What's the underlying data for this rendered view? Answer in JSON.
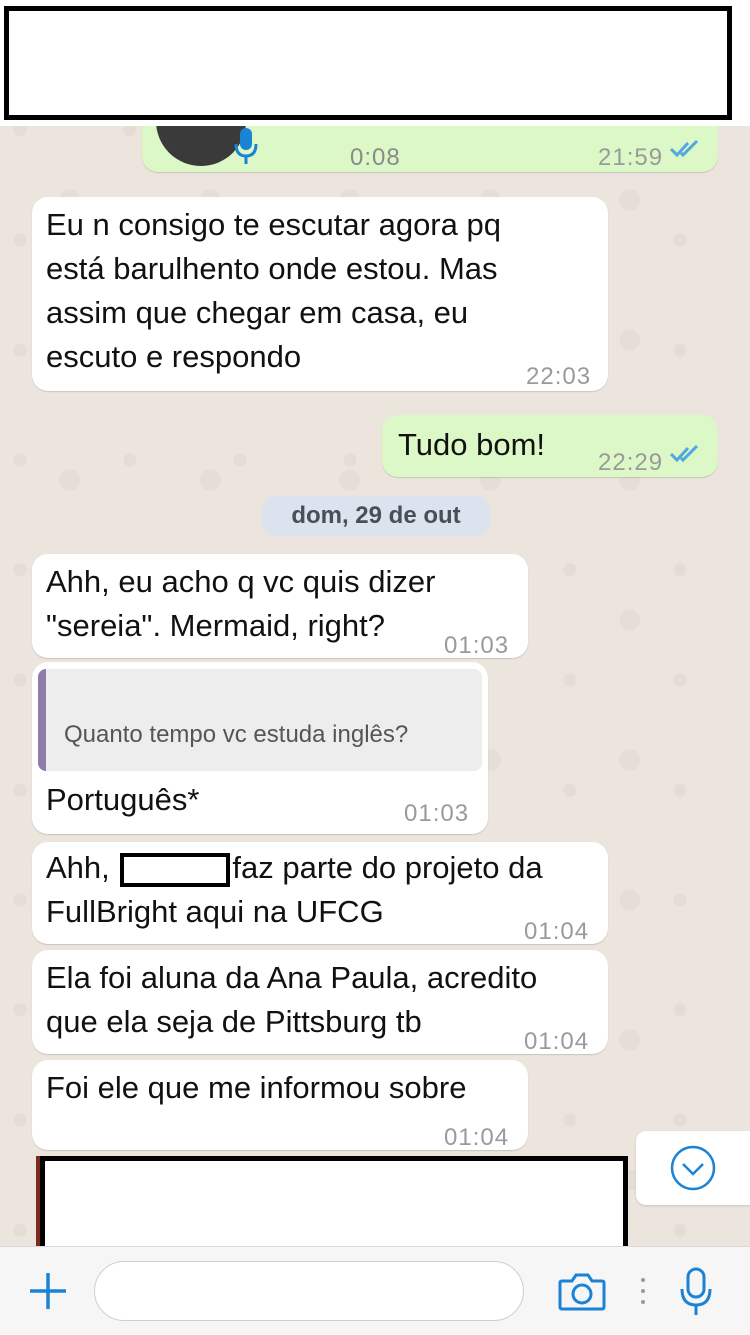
{
  "voice_message": {
    "duration": "0:08",
    "time": "21:59"
  },
  "messages": [
    {
      "text": "Eu n consigo te escutar agora pq\nestá barulhento onde estou. Mas\nassim que chegar em casa, eu\nescuto e respondo",
      "time": "22:03"
    },
    {
      "text": "Tudo bom!",
      "time": "22:29"
    },
    {
      "text": "Ahh, eu acho q vc quis dizer\n\"sereia\". Mermaid, right?",
      "time": "01:03"
    },
    {
      "quote": "Quanto tempo vc estuda inglês?",
      "text": "Português*",
      "time": "01:03"
    },
    {
      "text_before": "Ahh, ",
      "text_after": "faz parte do projeto da",
      "text_line2": "FullBright aqui na UFCG",
      "time": "01:04"
    },
    {
      "text": "Ela foi aluna da Ana Paula, acredito\nque ela seja de Pittsburg tb",
      "time": "01:04"
    },
    {
      "text": "Foi ele que me informou sobre",
      "time": "01:04"
    }
  ],
  "date_separator": "dom, 29 de out",
  "colors": {
    "incoming": "#ffffff",
    "outgoing": "#dcf8c6",
    "accent": "#1a83d5",
    "ticks": "#4fa8e0"
  },
  "icons": {
    "microphone": "microphone-icon",
    "read_ticks": "double-check-icon",
    "scroll_down": "chevron-down-circle-icon",
    "add": "plus-icon",
    "camera": "camera-icon",
    "voice": "microphone-icon"
  }
}
